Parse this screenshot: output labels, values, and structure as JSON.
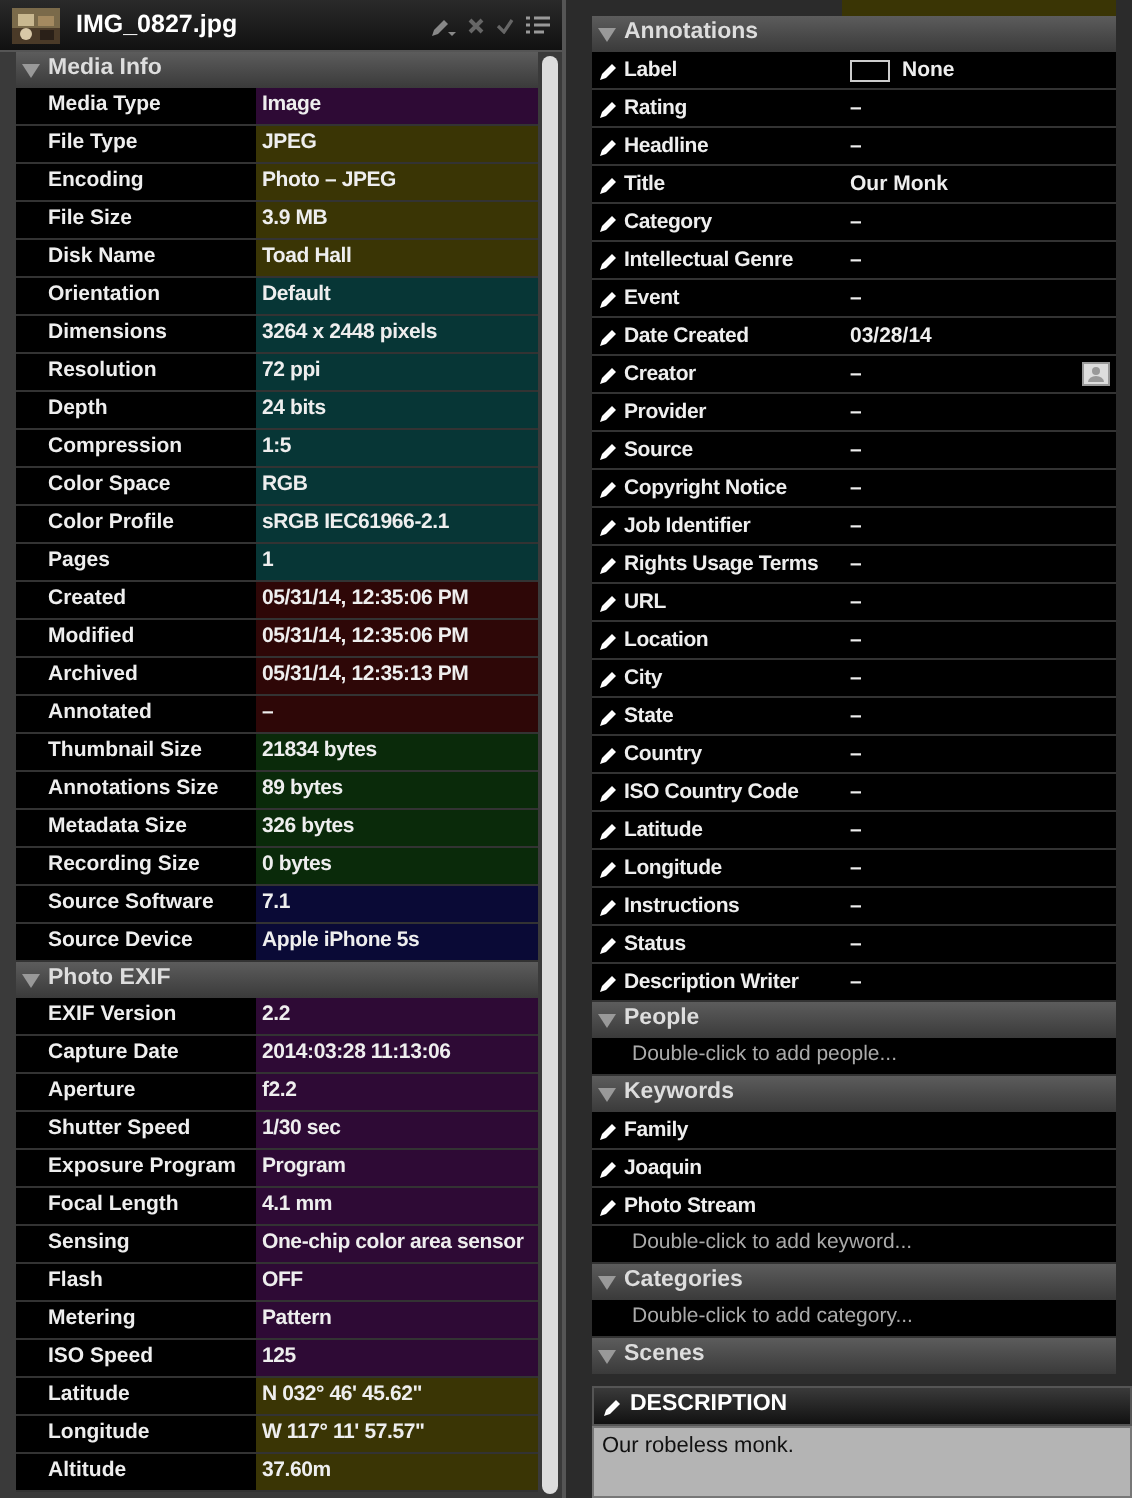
{
  "title": "IMG_0827.jpg",
  "left_sections": [
    {
      "title": "Media Info",
      "expanded": true,
      "rows": [
        {
          "label": "Media Type",
          "value": "Image",
          "color": "#2e0a35"
        },
        {
          "label": "File Type",
          "value": "JPEG",
          "color": "#3a3505"
        },
        {
          "label": "Encoding",
          "value": "Photo – JPEG",
          "color": "#3a3505"
        },
        {
          "label": "File Size",
          "value": "3.9 MB",
          "color": "#3a3505"
        },
        {
          "label": "Disk Name",
          "value": "Toad Hall",
          "color": "#3a3505"
        },
        {
          "label": "Orientation",
          "value": "Default",
          "color": "#073636"
        },
        {
          "label": "Dimensions",
          "value": "3264 x 2448 pixels",
          "color": "#073636"
        },
        {
          "label": "Resolution",
          "value": "72 ppi",
          "color": "#073636"
        },
        {
          "label": "Depth",
          "value": "24 bits",
          "color": "#073636"
        },
        {
          "label": "Compression",
          "value": "1:5",
          "color": "#073636"
        },
        {
          "label": "Color Space",
          "value": "RGB",
          "color": "#073636"
        },
        {
          "label": "Color Profile",
          "value": "sRGB IEC61966-2.1",
          "color": "#073636"
        },
        {
          "label": "Pages",
          "value": "1",
          "color": "#073636"
        },
        {
          "label": "Created",
          "value": "05/31/14, 12:35:06 PM",
          "color": "#2e0707"
        },
        {
          "label": "Modified",
          "value": "05/31/14, 12:35:06 PM",
          "color": "#2e0707"
        },
        {
          "label": "Archived",
          "value": "05/31/14, 12:35:13 PM",
          "color": "#2e0707"
        },
        {
          "label": "Annotated",
          "value": "–",
          "color": "#2e0707"
        },
        {
          "label": "Thumbnail Size",
          "value": "21834 bytes",
          "color": "#0a2a0a"
        },
        {
          "label": "Annotations Size",
          "value": "89 bytes",
          "color": "#0a2a0a"
        },
        {
          "label": "Metadata Size",
          "value": "326 bytes",
          "color": "#0a2a0a"
        },
        {
          "label": "Recording Size",
          "value": "0 bytes",
          "color": "#0a2a0a"
        },
        {
          "label": "Source Software",
          "value": "7.1",
          "color": "#0a0a36"
        },
        {
          "label": "Source Device",
          "value": "Apple iPhone 5s",
          "color": "#0a0a36"
        }
      ]
    },
    {
      "title": "Photo EXIF",
      "expanded": true,
      "rows": [
        {
          "label": "EXIF Version",
          "value": "2.2",
          "color": "#2e0a35"
        },
        {
          "label": "Capture Date",
          "value": "2014:03:28 11:13:06",
          "color": "#2e0a35"
        },
        {
          "label": "Aperture",
          "value": "f2.2",
          "color": "#2e0a35"
        },
        {
          "label": "Shutter Speed",
          "value": "1/30 sec",
          "color": "#2e0a35"
        },
        {
          "label": "Exposure Program",
          "value": "Program",
          "color": "#2e0a35"
        },
        {
          "label": "Focal Length",
          "value": "4.1 mm",
          "color": "#2e0a35"
        },
        {
          "label": "Sensing",
          "value": "One-chip color area sensor",
          "color": "#2e0a35"
        },
        {
          "label": "Flash",
          "value": "OFF",
          "color": "#2e0a35"
        },
        {
          "label": "Metering",
          "value": "Pattern",
          "color": "#2e0a35"
        },
        {
          "label": "ISO Speed",
          "value": "125",
          "color": "#2e0a35"
        },
        {
          "label": "Latitude",
          "value": "N 032° 46' 45.62\"",
          "color": "#3a3505"
        },
        {
          "label": "Longitude",
          "value": "W 117° 11' 57.57\"",
          "color": "#3a3505"
        },
        {
          "label": "Altitude",
          "value": "37.60m",
          "color": "#3a3505"
        }
      ]
    }
  ],
  "right_sections": [
    {
      "title": "Annotations",
      "expanded": true,
      "fields": [
        {
          "label": "Label",
          "value": "None",
          "kind": "swatch"
        },
        {
          "label": "Rating",
          "value": "–",
          "kind": "text"
        },
        {
          "label": "Headline",
          "value": "–",
          "kind": "text"
        },
        {
          "label": "Title",
          "value": "Our Monk",
          "kind": "text"
        },
        {
          "label": "Category",
          "value": "–",
          "kind": "text"
        },
        {
          "label": "Intellectual Genre",
          "value": "–",
          "kind": "text"
        },
        {
          "label": "Event",
          "value": "–",
          "kind": "text"
        },
        {
          "label": "Date Created",
          "value": "03/28/14",
          "kind": "text"
        },
        {
          "label": "Creator",
          "value": "–",
          "kind": "person"
        },
        {
          "label": "Provider",
          "value": "–",
          "kind": "text"
        },
        {
          "label": "Source",
          "value": "–",
          "kind": "text"
        },
        {
          "label": "Copyright Notice",
          "value": "–",
          "kind": "text"
        },
        {
          "label": "Job Identifier",
          "value": "–",
          "kind": "text"
        },
        {
          "label": "Rights Usage Terms",
          "value": "–",
          "kind": "text"
        },
        {
          "label": "URL",
          "value": "–",
          "kind": "text"
        },
        {
          "label": "Location",
          "value": "–",
          "kind": "text"
        },
        {
          "label": "City",
          "value": "–",
          "kind": "text"
        },
        {
          "label": "State",
          "value": "–",
          "kind": "text"
        },
        {
          "label": "Country",
          "value": "–",
          "kind": "text"
        },
        {
          "label": "ISO Country Code",
          "value": "–",
          "kind": "text"
        },
        {
          "label": "Latitude",
          "value": "–",
          "kind": "text"
        },
        {
          "label": "Longitude",
          "value": "–",
          "kind": "text"
        },
        {
          "label": "Instructions",
          "value": "–",
          "kind": "text"
        },
        {
          "label": "Status",
          "value": "–",
          "kind": "text"
        },
        {
          "label": "Description Writer",
          "value": "–",
          "kind": "text"
        }
      ]
    },
    {
      "title": "People",
      "expanded": true,
      "hint": "Double-click to add people..."
    },
    {
      "title": "Keywords",
      "expanded": true,
      "items": [
        "Family",
        "Joaquin",
        "Photo Stream"
      ],
      "hint": "Double-click to add keyword..."
    },
    {
      "title": "Categories",
      "expanded": true,
      "hint": "Double-click to add category..."
    },
    {
      "title": "Scenes",
      "expanded": true
    }
  ],
  "description": {
    "title": "DESCRIPTION",
    "text": "Our robeless monk."
  }
}
